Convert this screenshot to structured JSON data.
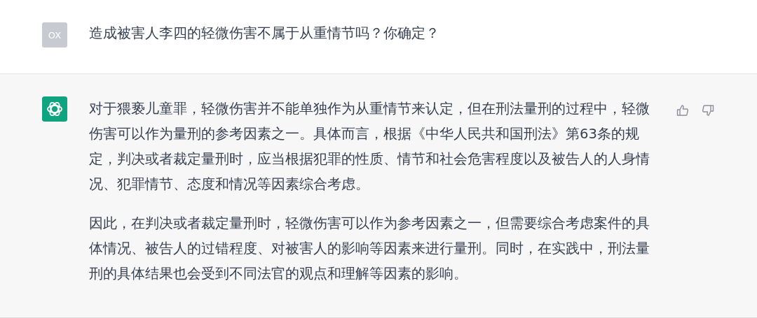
{
  "messages": [
    {
      "kind": "user",
      "avatar": "OX",
      "paragraphs": [
        "造成被害人李四的轻微伤害不属于从重情节吗？你确定？"
      ]
    },
    {
      "kind": "assistant",
      "paragraphs": [
        "对于猥亵儿童罪，轻微伤害并不能单独作为从重情节来认定，但在刑法量刑的过程中，轻微伤害可以作为量刑的参考因素之一。具体而言，根据《中华人民共和国刑法》第63条的规定，判决或者裁定量刑时，应当根据犯罪的性质、情节和社会危害程度以及被告人的人身情况、犯罪情节、态度和情况等因素综合考虑。",
        "因此，在判决或者裁定量刑时，轻微伤害可以作为参考因素之一，但需要综合考虑案件的具体情况、被告人的过错程度、对被害人的影响等因素来进行量刑。同时，在实践中，刑法量刑的具体结果也会受到不同法官的观点和理解等因素的影响。"
      ]
    }
  ]
}
